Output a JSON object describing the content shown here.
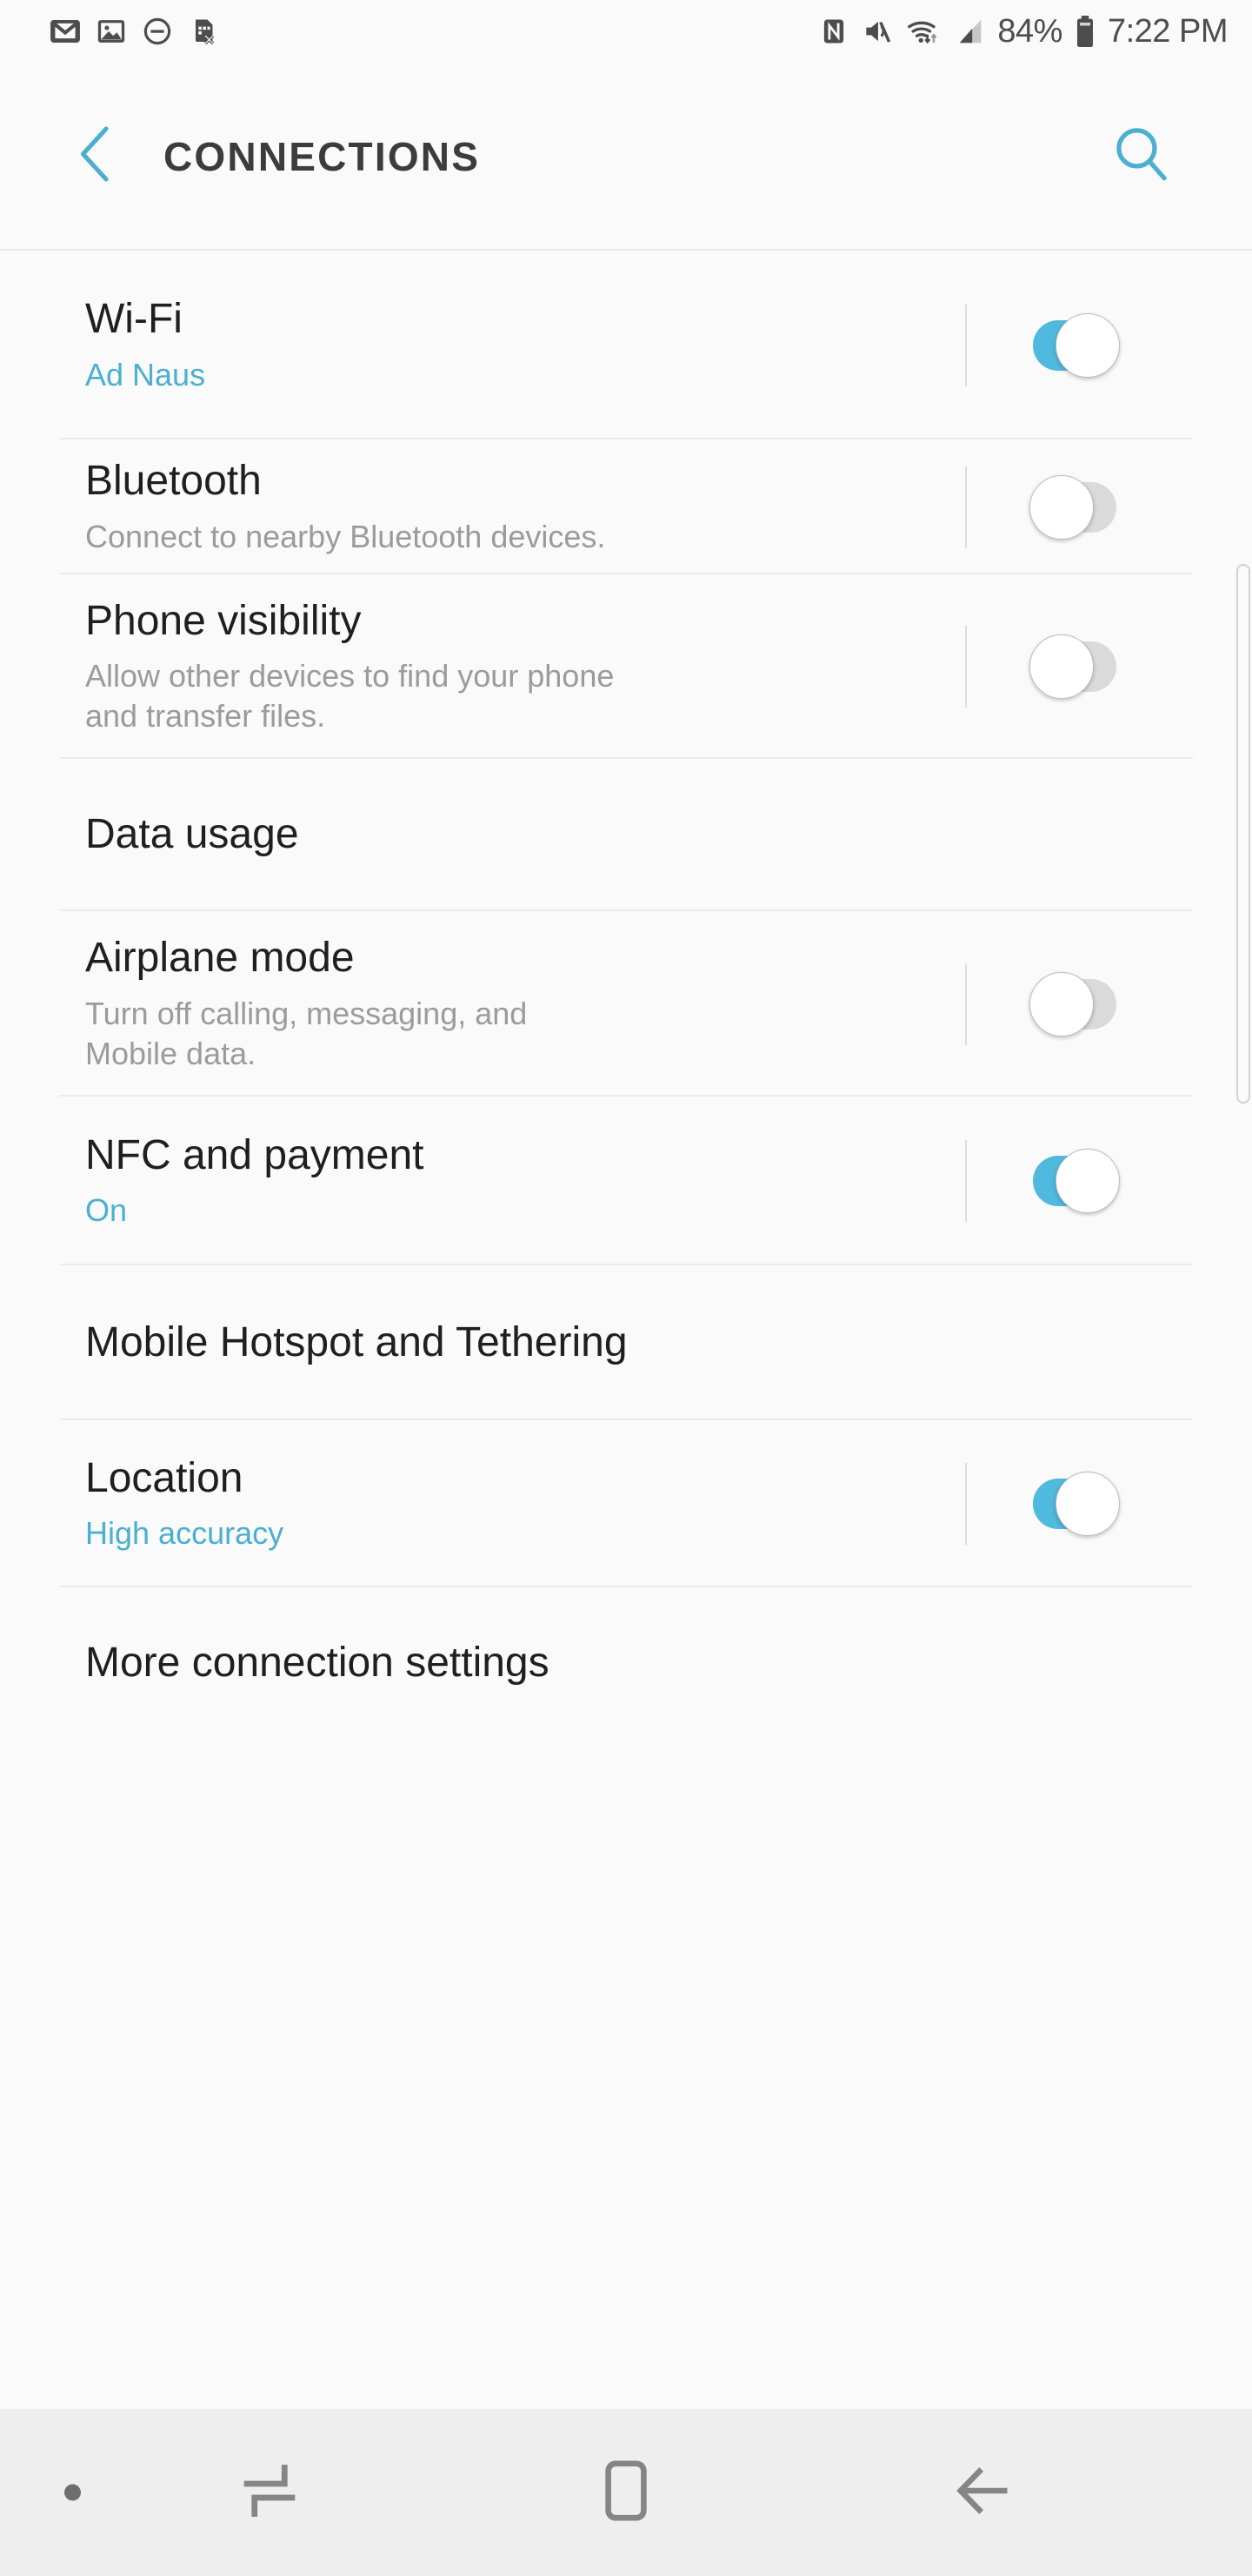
{
  "status_bar": {
    "left_icons": [
      {
        "name": "gmail-icon",
        "label": "Gmail"
      },
      {
        "name": "photos-icon",
        "label": "Photos"
      },
      {
        "name": "do-not-disturb-icon",
        "label": "Do not disturb"
      },
      {
        "name": "sim-card-disabled-icon",
        "label": "No SIM card"
      }
    ],
    "right_icons": [
      {
        "name": "nfc-icon",
        "label": "NFC"
      },
      {
        "name": "mute-icon",
        "label": "Sound muted"
      },
      {
        "name": "wifi-icon",
        "label": "Wi-Fi connected"
      },
      {
        "name": "cellular-signal-icon",
        "label": "Signal strength"
      }
    ],
    "battery_percent": "84%",
    "clock": "7:22 PM"
  },
  "header": {
    "title": "CONNECTIONS",
    "back_icon": "chevron-left-icon",
    "search_icon": "search-icon",
    "accent_color": "#4aafd0"
  },
  "settings": {
    "rows": [
      {
        "id": "wifi",
        "title": "Wi-Fi",
        "subtitle": "Ad Naus",
        "subtitle_accent": true,
        "has_toggle": true,
        "toggle_on": true
      },
      {
        "id": "bluetooth",
        "title": "Bluetooth",
        "subtitle": "Connect to nearby Bluetooth devices.",
        "subtitle_accent": false,
        "has_toggle": true,
        "toggle_on": false
      },
      {
        "id": "phone-visibility",
        "title": "Phone visibility",
        "subtitle": "Allow other devices to find your phone and transfer files.",
        "subtitle_accent": false,
        "has_toggle": true,
        "toggle_on": false
      },
      {
        "id": "data-usage",
        "title": "Data usage",
        "subtitle": "",
        "subtitle_accent": false,
        "has_toggle": false,
        "toggle_on": false
      },
      {
        "id": "airplane-mode",
        "title": "Airplane mode",
        "subtitle": "Turn off calling, messaging, and Mobile data.",
        "subtitle_accent": false,
        "has_toggle": true,
        "toggle_on": false
      },
      {
        "id": "nfc-and-payment",
        "title": "NFC and payment",
        "subtitle": "On",
        "subtitle_accent": true,
        "has_toggle": true,
        "toggle_on": true
      },
      {
        "id": "mobile-hotspot-and-tethering",
        "title": "Mobile Hotspot and Tethering",
        "subtitle": "",
        "subtitle_accent": false,
        "has_toggle": false,
        "toggle_on": false
      },
      {
        "id": "location",
        "title": "Location",
        "subtitle": "High accuracy",
        "subtitle_accent": true,
        "has_toggle": true,
        "toggle_on": true
      },
      {
        "id": "more-connection-settings",
        "title": "More connection settings",
        "subtitle": "",
        "subtitle_accent": false,
        "has_toggle": false,
        "toggle_on": false
      }
    ]
  },
  "nav_bar": {
    "buttons": [
      {
        "name": "notification-dot-icon",
        "label": "Notification indicator"
      },
      {
        "name": "recents-icon",
        "label": "Recents"
      },
      {
        "name": "home-icon",
        "label": "Home"
      },
      {
        "name": "back-icon",
        "label": "Back"
      }
    ]
  },
  "colors": {
    "accent": "#4fb9de",
    "background": "#fafafa",
    "nav_background": "#eeeeee",
    "title_text": "#1f1f1f",
    "subtitle_text": "#9b9b9b",
    "divider": "#ebebeb"
  }
}
